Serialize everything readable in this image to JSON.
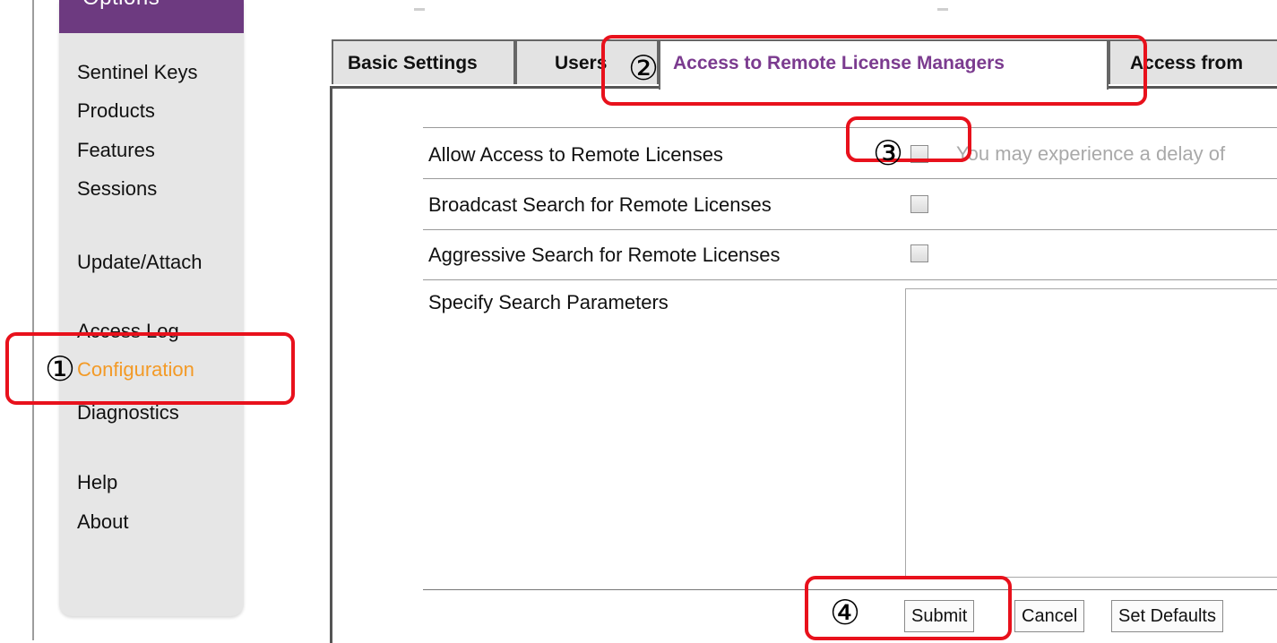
{
  "sidebar": {
    "header": "Options",
    "items": [
      {
        "label": "Sentinel Keys"
      },
      {
        "label": "Products"
      },
      {
        "label": "Features"
      },
      {
        "label": "Sessions"
      },
      {
        "label": "Update/Attach"
      },
      {
        "label": "Access Log"
      },
      {
        "label": "Configuration"
      },
      {
        "label": "Diagnostics"
      },
      {
        "label": "Help"
      },
      {
        "label": "About"
      }
    ],
    "active_item": "Configuration",
    "active_color": "#f39a26",
    "header_color": "#6d3a80"
  },
  "tabs": [
    {
      "label": "Basic Settings"
    },
    {
      "label": "Users"
    },
    {
      "label": "Access to Remote License Managers",
      "active": true
    },
    {
      "label": "Access from"
    }
  ],
  "form": {
    "rows": [
      {
        "label": "Allow Access to Remote Licenses",
        "checked": false,
        "hint": "You may experience a delay of"
      },
      {
        "label": "Broadcast Search for Remote Licenses",
        "checked": false
      },
      {
        "label": "Aggressive Search for Remote Licenses",
        "checked": false
      },
      {
        "label": "Specify Search Parameters",
        "value": ""
      }
    ]
  },
  "buttons": {
    "submit": "Submit",
    "cancel": "Cancel",
    "set_defaults": "Set Defaults"
  },
  "annotations": {
    "color": "#e8111c",
    "labels": [
      "①",
      "②",
      "③",
      "④"
    ]
  }
}
